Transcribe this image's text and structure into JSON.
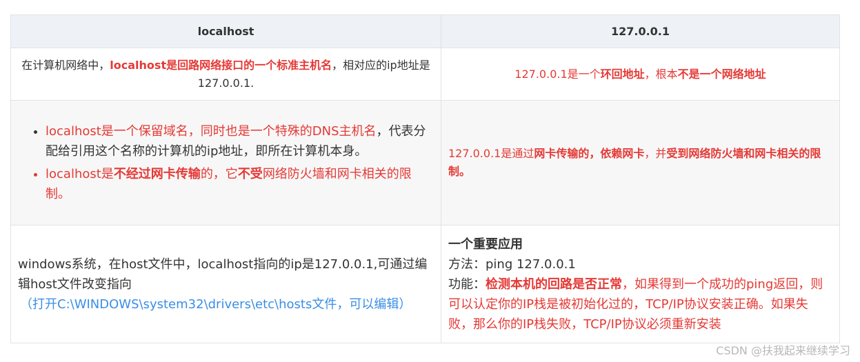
{
  "table": {
    "headers": [
      "localhost",
      "127.0.0.1"
    ],
    "row1": {
      "left": {
        "t1": "在计算机网络中，",
        "t2": "localhost是回路网络接口的一个标准主机名",
        "t3": "，相对应的ip地址是127.0.0.1."
      },
      "right": {
        "t1": "127.0.0.1是一个",
        "t2": "环回地址",
        "t3": "，根本",
        "t4": "不是一个网络地址"
      }
    },
    "row2": {
      "left": {
        "item1": {
          "t1": "localhost是一个保留域名，同时也是一个特殊的DNS主机名",
          "t2": "，代表分配给引用这个名称的计算机的ip地址，即所在计算机本身。"
        },
        "item2": {
          "t1": "localhost是",
          "t2": "不经过网卡传输",
          "t3": "的，它",
          "t4": "不受",
          "t5": "网络防火墙和网卡相关的限制。"
        }
      },
      "right": {
        "t1": "127.0.0.1是通过",
        "t2": "网卡传输的",
        "t3": "，",
        "t4": "依赖网卡",
        "t5": "，并",
        "t6": "受到网络防火墙和网卡相关的限制。"
      }
    },
    "row3": {
      "left": {
        "t1": "windows系统，在host文件中，localhost指向的ip是127.0.0.1,可通过编辑host文件改变指向",
        "t2": "（打开C:\\WINDOWS\\system32\\drivers\\etc\\hosts文件，可以编辑）"
      },
      "right": {
        "heading": "一个重要应用",
        "method": "方法：ping 127.0.0.1",
        "func_label": "功能：",
        "func_bold": "检测本机的回路是否正常",
        "func_rest": "，如果得到一个成功的ping返回，则可以认定你的IP栈是被初始化过的，TCP/IP协议安装正确。如果失败，那么你的IP栈失败，TCP/IP协议必须重新安装"
      }
    }
  },
  "watermark": "CSDN @扶我起来继续学习",
  "colors": {
    "red": "#e53935",
    "blue": "#3a8ee6",
    "header_bg": "#eef1f5",
    "stripe_bg": "#f7f7f7",
    "border": "#dfe2e5"
  }
}
